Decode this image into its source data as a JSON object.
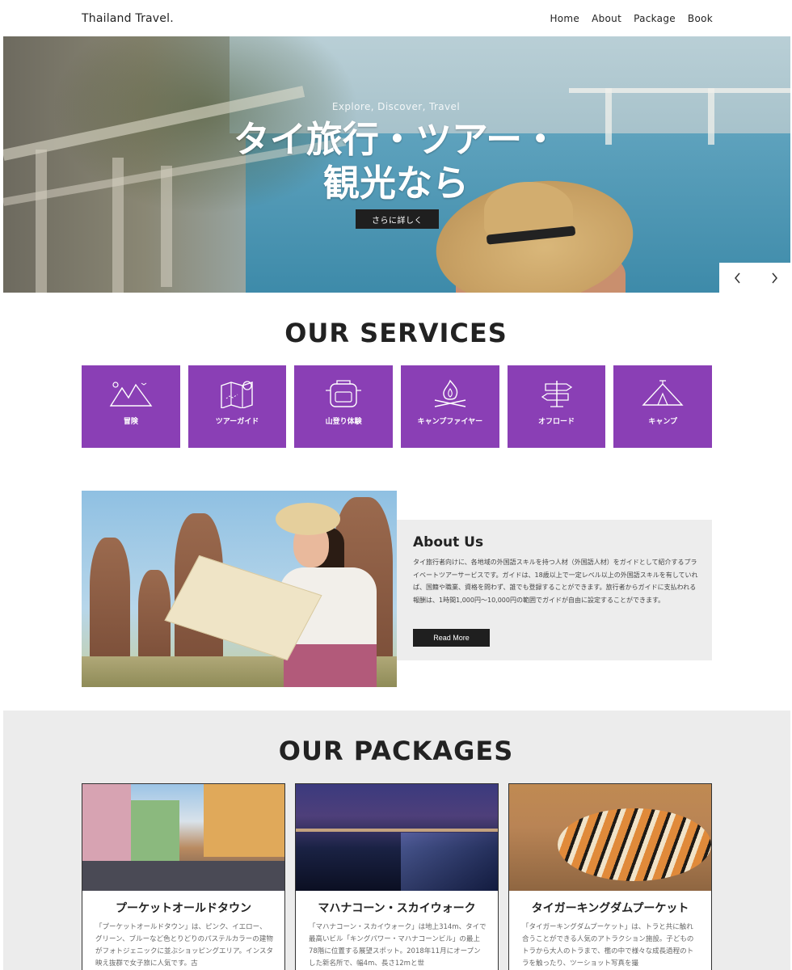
{
  "nav": {
    "brand": "Thailand Travel.",
    "items": [
      "Home",
      "About",
      "Package",
      "Book"
    ]
  },
  "hero": {
    "subtitle": "Explore, Discover, Travel",
    "title_line1": "タイ旅行・ツアー・",
    "title_line2": "観光なら",
    "button": "さらに詳しく",
    "prev_icon": "chevron-left-icon",
    "next_icon": "chevron-right-icon"
  },
  "services": {
    "title": "OUR SERVICES",
    "accent_color": "#8a3fb5",
    "items": [
      {
        "label": "冒険",
        "icon": "mountains-icon"
      },
      {
        "label": "ツアーガイド",
        "icon": "map-pin-icon"
      },
      {
        "label": "山登り体験",
        "icon": "backpack-icon"
      },
      {
        "label": "キャンプファイヤー",
        "icon": "campfire-icon"
      },
      {
        "label": "オフロード",
        "icon": "signpost-icon"
      },
      {
        "label": "キャンプ",
        "icon": "tent-icon"
      }
    ]
  },
  "about": {
    "title": "About Us",
    "text": "タイ旅行者向けに、各地域の外国語スキルを持つ人材（外国語人材）をガイドとして紹介するプライベートツアーサービスです。ガイドは、18歳以上で一定レベル以上の外国語スキルを有していれば、国籍や職業、資格を問わず、誰でも登録することができます。旅行者からガイドに支払われる報酬は、1時間1,000円〜10,000円の範囲でガイドが自由に設定することができます。",
    "button": "Read More"
  },
  "packages": {
    "title": "OUR PACKAGES",
    "items": [
      {
        "title": "プーケットオールドタウン",
        "text": "「プーケットオールドタウン」は、ピンク、イエロー、グリーン、ブルーなど色とりどりのパステルカラーの建物がフォトジェニックに並ぶショッピングエリア。インスタ映え抜群で女子旅に人気です。古"
      },
      {
        "title": "マハナコーン・スカイウォーク",
        "text": "「マハナコーン・スカイウォーク」は地上314m、タイで最高いビル「キングパワー・マハナコーンビル」の最上78階に位置する展望スポット。2018年11月にオープンした新名所で、幅4m、長さ12mと世"
      },
      {
        "title": "タイガーキングダムプーケット",
        "text": "「タイガーキングダムプーケット」は、トラと共に触れ合うことができる人気のアトラクション施設。子どものトラから大人のトラまで、檻の中で様々な成長過程のトラを触ったり、ツーショット写真を撮"
      }
    ]
  }
}
